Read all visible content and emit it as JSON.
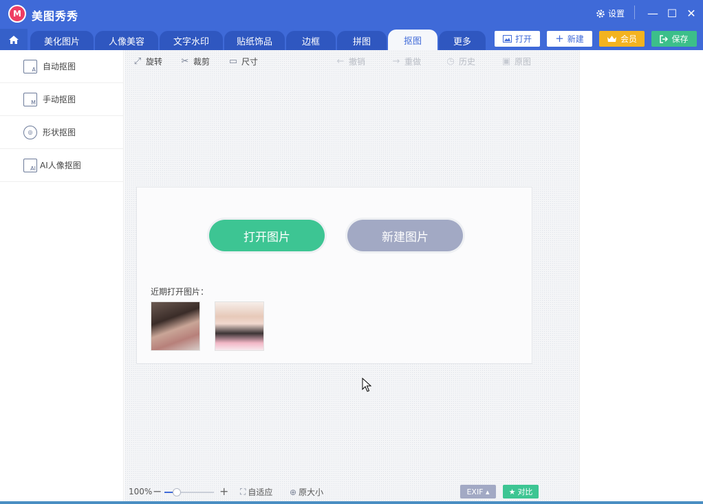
{
  "app": {
    "logo_glyph": "M",
    "title": "美图秀秀"
  },
  "titlebar": {
    "settings_label": "设置",
    "minimize_glyph": "—",
    "maximize_glyph": "☐",
    "close_glyph": "✕"
  },
  "tabs": [
    {
      "label": "美化图片"
    },
    {
      "label": "人像美容"
    },
    {
      "label": "文字水印"
    },
    {
      "label": "贴纸饰品"
    },
    {
      "label": "边框"
    },
    {
      "label": "拼图"
    },
    {
      "label": "抠图",
      "active": true
    },
    {
      "label": "更多"
    }
  ],
  "header_buttons": {
    "open_label": "打开",
    "new_label": "新建",
    "vip_label": "会员",
    "save_label": "保存"
  },
  "left_panel": {
    "items": [
      {
        "label": "自动抠图",
        "icon_glyph": "A"
      },
      {
        "label": "手动抠图",
        "icon_glyph": "M"
      },
      {
        "label": "形状抠图",
        "icon_glyph": "◎"
      },
      {
        "label": "AI人像抠图",
        "icon_glyph": "AI"
      }
    ]
  },
  "toolbar": {
    "rotate_label": "旋转",
    "crop_label": "裁剪",
    "size_label": "尺寸",
    "undo_label": "撤销",
    "redo_label": "重做",
    "history_label": "历史",
    "original_label": "原图"
  },
  "center": {
    "open_image_label": "打开图片",
    "new_image_label": "新建图片",
    "recent_label": "近期打开图片："
  },
  "bottom_bar": {
    "zoom_percent": "100%",
    "zoom_level": 0.25,
    "minus_glyph": "−",
    "plus_glyph": "+",
    "fit_label": "自适应",
    "actual_size_label": "原大小",
    "exif_label": "EXIF ▴",
    "compare_label": "对比"
  },
  "colors": {
    "brand_blue": "#3f6ad8",
    "open_green": "#3dc593",
    "new_gray": "#a2a9c4",
    "vip_gold": "#f3b320",
    "save_green": "#3cbf8a"
  }
}
